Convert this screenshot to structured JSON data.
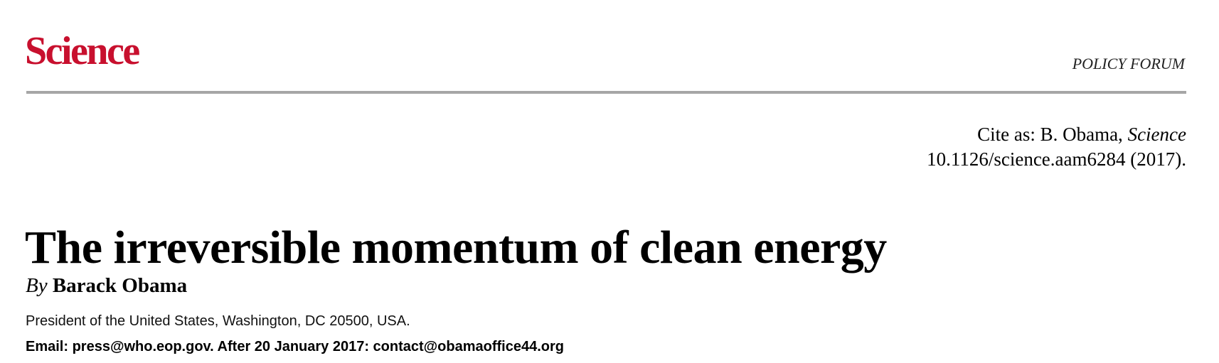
{
  "header": {
    "journal_name": "Science",
    "section": "POLICY FORUM"
  },
  "citation": {
    "prefix": "Cite as: B. Obama,",
    "journal": "Science",
    "doi_year": "10.1126/science.aam6284 (2017)."
  },
  "article": {
    "title": "The irreversible momentum of clean energy",
    "by_label": "By",
    "author": "Barack Obama",
    "affiliation": "President of the United States, Washington, DC 20500, USA.",
    "email_line": "Email: press@who.eop.gov. After 20 January 2017: contact@obamaoffice44.org"
  },
  "colors": {
    "brand": "#c8102e",
    "rule": "#a6a6a6"
  }
}
